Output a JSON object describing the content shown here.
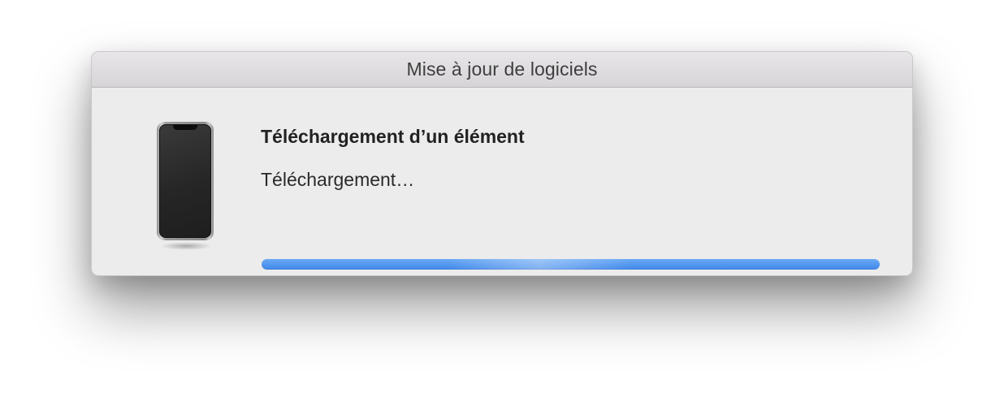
{
  "window": {
    "title": "Mise à jour de logiciels"
  },
  "content": {
    "heading": "Téléchargement d’un élément",
    "status": "Téléchargement…",
    "device_icon": "iphone-icon"
  },
  "progress": {
    "value": 1.0,
    "indeterminate": true
  },
  "colors": {
    "accent": "#4a8ff0",
    "window_bg": "#ececec",
    "titlebar_bg": "#dedcde"
  }
}
